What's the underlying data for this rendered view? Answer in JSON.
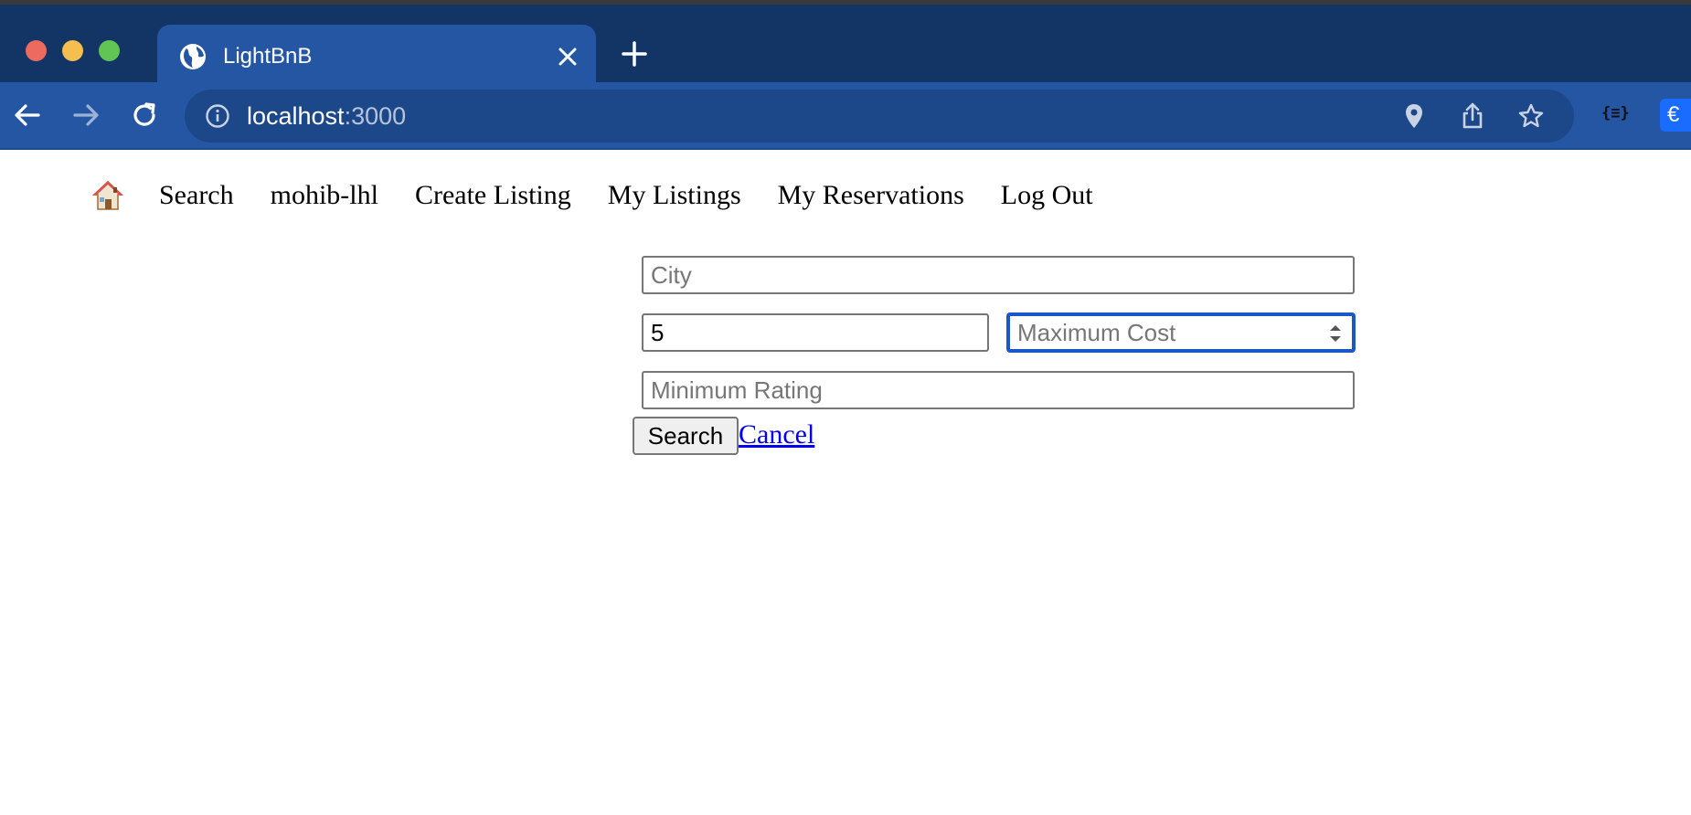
{
  "browser": {
    "tab_title": "LightBnB",
    "url_host": "localhost",
    "url_port": ":3000",
    "extension_json_label": "{≡}",
    "extension_euro_label": "€"
  },
  "nav": {
    "home_icon": "house-emoji",
    "links": [
      "Search",
      "mohib-lhl",
      "Create Listing",
      "My Listings",
      "My Reservations",
      "Log Out"
    ]
  },
  "search_form": {
    "city_placeholder": "City",
    "city_value": "",
    "min_cost_value": "5",
    "max_cost_placeholder": "Maximum Cost",
    "max_cost_value": "",
    "min_rating_placeholder": "Minimum Rating",
    "min_rating_value": "",
    "search_label": "Search",
    "cancel_label": "Cancel"
  },
  "colors": {
    "titlebar": "#133565",
    "toolbar": "#2456a4",
    "focus_ring": "#1a57c8",
    "link": "#0000ee"
  }
}
